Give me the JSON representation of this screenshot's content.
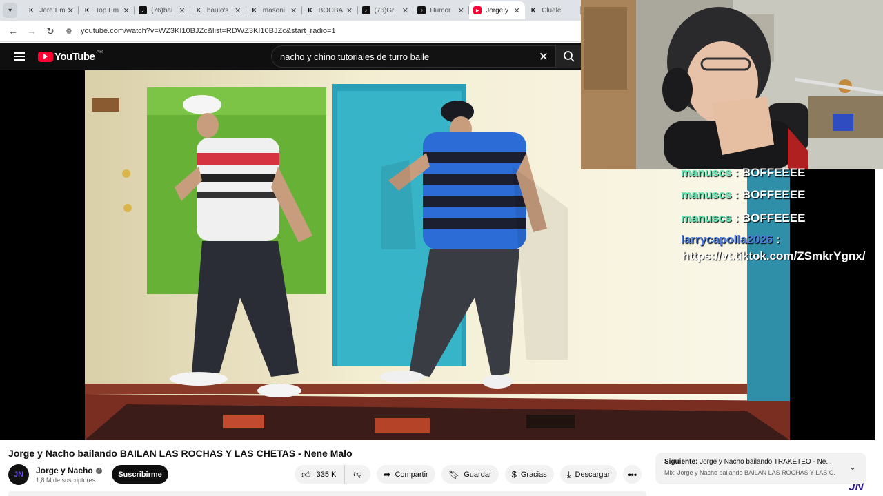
{
  "browser": {
    "tabs": [
      {
        "label": "Jere Em",
        "favicon": "kick-icon",
        "active": false
      },
      {
        "label": "Top Em",
        "favicon": "kick-icon",
        "active": false
      },
      {
        "label": "(76)bai",
        "favicon": "tiktok-icon",
        "active": false
      },
      {
        "label": "baulo's",
        "favicon": "kick-icon",
        "active": false
      },
      {
        "label": "masoni",
        "favicon": "kick-icon",
        "active": false
      },
      {
        "label": "BOOBA",
        "favicon": "kick-icon",
        "active": false
      },
      {
        "label": "(76)Gri",
        "favicon": "tiktok-icon",
        "active": false
      },
      {
        "label": "Humor",
        "favicon": "tiktok-icon",
        "active": false
      },
      {
        "label": "Jorge y",
        "favicon": "youtube-icon",
        "active": true
      },
      {
        "label": "Cluele",
        "favicon": "kick-icon",
        "active": false
      }
    ],
    "url": "youtube.com/watch?v=WZ3KI10BJZc&list=RDWZ3KI10BJZc&start_radio=1"
  },
  "youtube": {
    "logo_text": "YouTube",
    "region": "AR",
    "search_value": "nacho y chino tutoriales de turro baile"
  },
  "video": {
    "title": "Jorge y Nacho bailando BAILAN LAS ROCHAS Y LAS CHETAS - Nene Malo",
    "watermark": "JN"
  },
  "channel": {
    "name": "Jorge y Nacho",
    "subscribers": "1,8 M de suscriptores",
    "subscribe_label": "Suscribirme",
    "avatar_text": "JN"
  },
  "actions": {
    "likes": "335 K",
    "share": "Compartir",
    "save": "Guardar",
    "thanks": "Gracias",
    "download": "Descargar"
  },
  "next_up": {
    "label": "Siguiente:",
    "title": "Jorge y Nacho bailando TRAKETEO - Ne...",
    "mix": "Mix: Jorge y Nacho bailando BAILAN LAS ROCHAS Y LAS C..."
  },
  "chat": {
    "messages": [
      {
        "user": "manuscs",
        "sep": " : ",
        "text": "BOFFEEEE"
      },
      {
        "user": "manuscs",
        "sep": " : ",
        "text": "BOFFEEEE"
      },
      {
        "user": "manuscs",
        "sep": " : ",
        "text": "BOFFEEEE"
      },
      {
        "user": "larrycapolla2026",
        "sep": " :",
        "text": ""
      }
    ],
    "link": "https://vt.tiktok.com/ZSmkrYgnx/",
    "user_colors": {
      "green": "#5de6b3",
      "blue": "#4e7fe0"
    }
  },
  "colors": {
    "youtube_red": "#ff0033",
    "dark_bg": "#0f0f0f"
  }
}
